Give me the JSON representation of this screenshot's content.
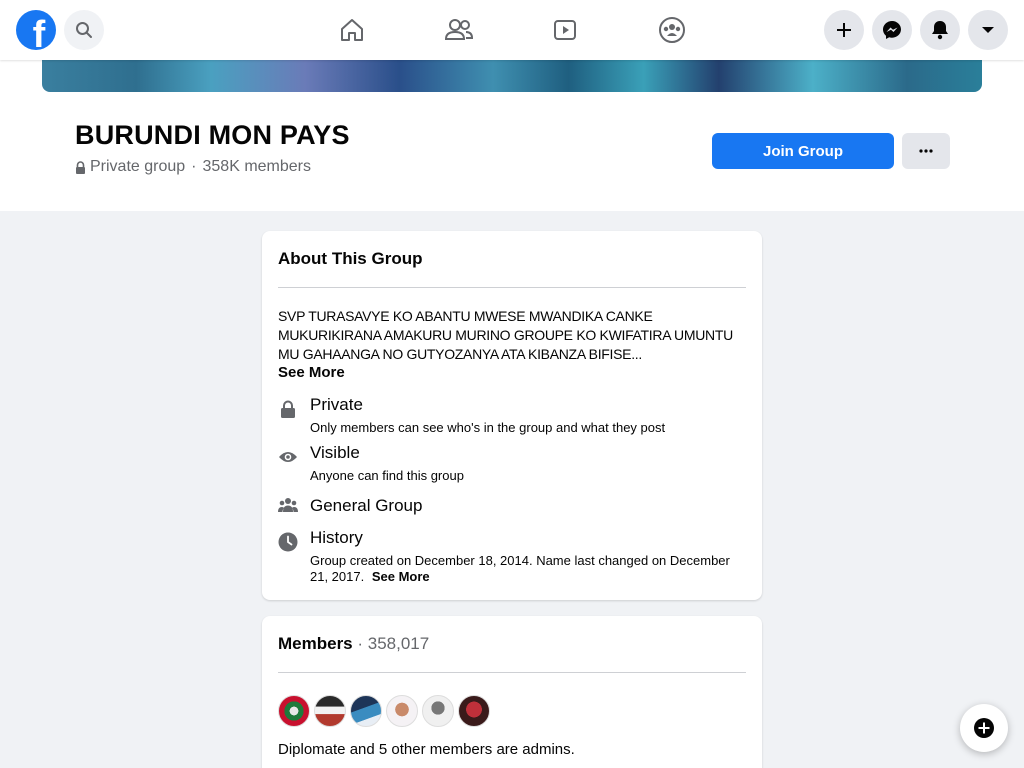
{
  "brand": {
    "logo_letter": "f",
    "color": "#1877f2"
  },
  "nav": {
    "icons": [
      "home-icon",
      "friends-icon",
      "watch-icon",
      "groups-icon"
    ],
    "right_buttons": [
      "create-icon",
      "messenger-icon",
      "notifications-icon",
      "account-menu-icon"
    ]
  },
  "group": {
    "name": "BURUNDI MON PAYS",
    "privacy": "Private group",
    "separator": "·",
    "members_short": "358K members",
    "join_label": "Join Group",
    "more_label": "···"
  },
  "about": {
    "title": "About This Group",
    "description": "SVP TURASAVYE KO ABANTU MWESE MWANDIKA CANKE MUKURIKIRANA AMAKURU MURINO GROUPE KO KWIFATIRA UMUNTU MU GAHAANGA NO GUTYOZANYA ATA KIBANZA BIFISE...",
    "see_more": "See More",
    "private_title": "Private",
    "private_sub": "Only members can see who's in the group and what they post",
    "visible_title": "Visible",
    "visible_sub": "Anyone can find this group",
    "general_title": "General Group",
    "history_title": "History",
    "history_sub": "Group created on December 18, 2014. Name last changed on December 21, 2017.",
    "history_see_more": "See More"
  },
  "members": {
    "title": "Members",
    "separator": " · ",
    "count": "358,017",
    "admins_text": "Diplomate and 5 other members are admins."
  },
  "colors": {
    "accent": "#1877f2",
    "muted": "#65676b",
    "bg": "#f0f2f5"
  }
}
